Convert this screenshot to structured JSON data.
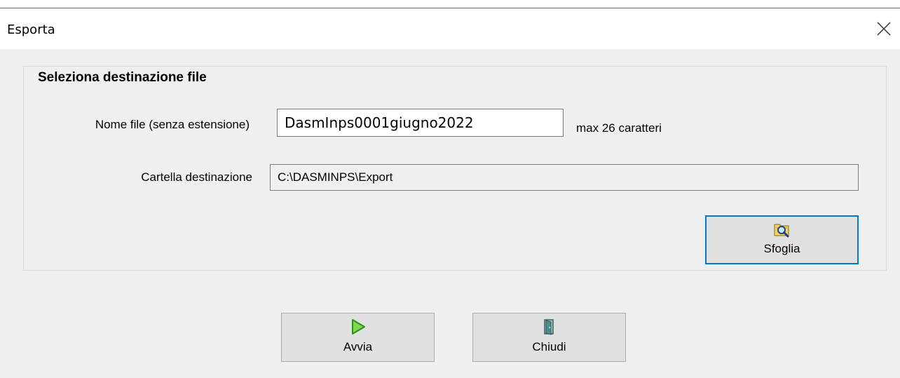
{
  "window": {
    "title": "Esporta"
  },
  "group": {
    "title": "Seleziona destinazione file"
  },
  "file_name": {
    "label": "Nome file (senza estensione)",
    "value": "DasmInps0001giugno2022",
    "hint": "max 26 caratteri"
  },
  "destination": {
    "label": "Cartella destinazione",
    "value": "C:\\DASMINPS\\Export"
  },
  "buttons": {
    "browse": {
      "label": "Sfoglia",
      "icon": "folder-search-icon"
    },
    "start": {
      "label": "Avvia",
      "icon": "play-icon"
    },
    "close": {
      "label": "Chiudi",
      "icon": "exit-door-icon"
    }
  },
  "colors": {
    "focus_border": "#0078d7",
    "dialog_bg": "#f0f0f0",
    "button_bg": "#e1e1e1",
    "play_green": "#4caf1f"
  }
}
